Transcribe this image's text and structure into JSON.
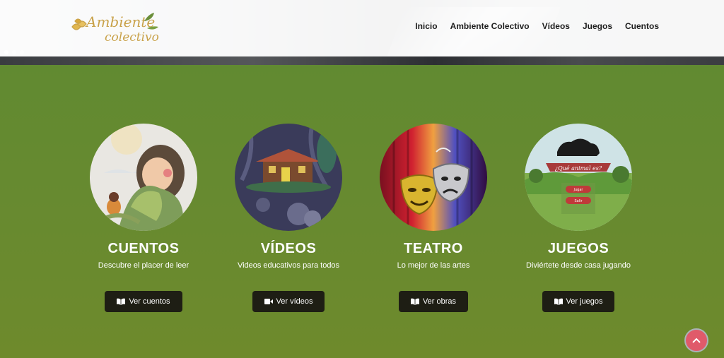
{
  "header": {
    "logo_text_line1": "Ambiente",
    "logo_text_line2": "colectivo",
    "nav": [
      "Inicio",
      "Ambiente Colectivo",
      "Vídeos",
      "Juegos",
      "Cuentos"
    ]
  },
  "slider": {
    "dots": 3,
    "active": 0
  },
  "cards": [
    {
      "title": "CUENTOS",
      "subtitle": "Descubre el placer de leer",
      "button": "Ver cuentos",
      "button_icon": "book-icon"
    },
    {
      "title": "VÍDEOS",
      "subtitle": "Videos educativos para todos",
      "button": "Ver vídeos",
      "button_icon": "video-camera-icon"
    },
    {
      "title": "TEATRO",
      "subtitle": "Lo mejor de las artes",
      "button": "Ver obras",
      "button_icon": "book-icon"
    },
    {
      "title": "JUEGOS",
      "subtitle": "Diviértete desde casa jugando",
      "button": "Ver juegos",
      "button_icon": "book-icon"
    }
  ],
  "game_thumb": {
    "banner": "¿Qué animal es?",
    "btn1": "Jugar",
    "btn2": "Salir"
  },
  "colors": {
    "background": "#5f8a2c",
    "button": "#1e1e14",
    "scroll_top": "#e05a6a"
  }
}
